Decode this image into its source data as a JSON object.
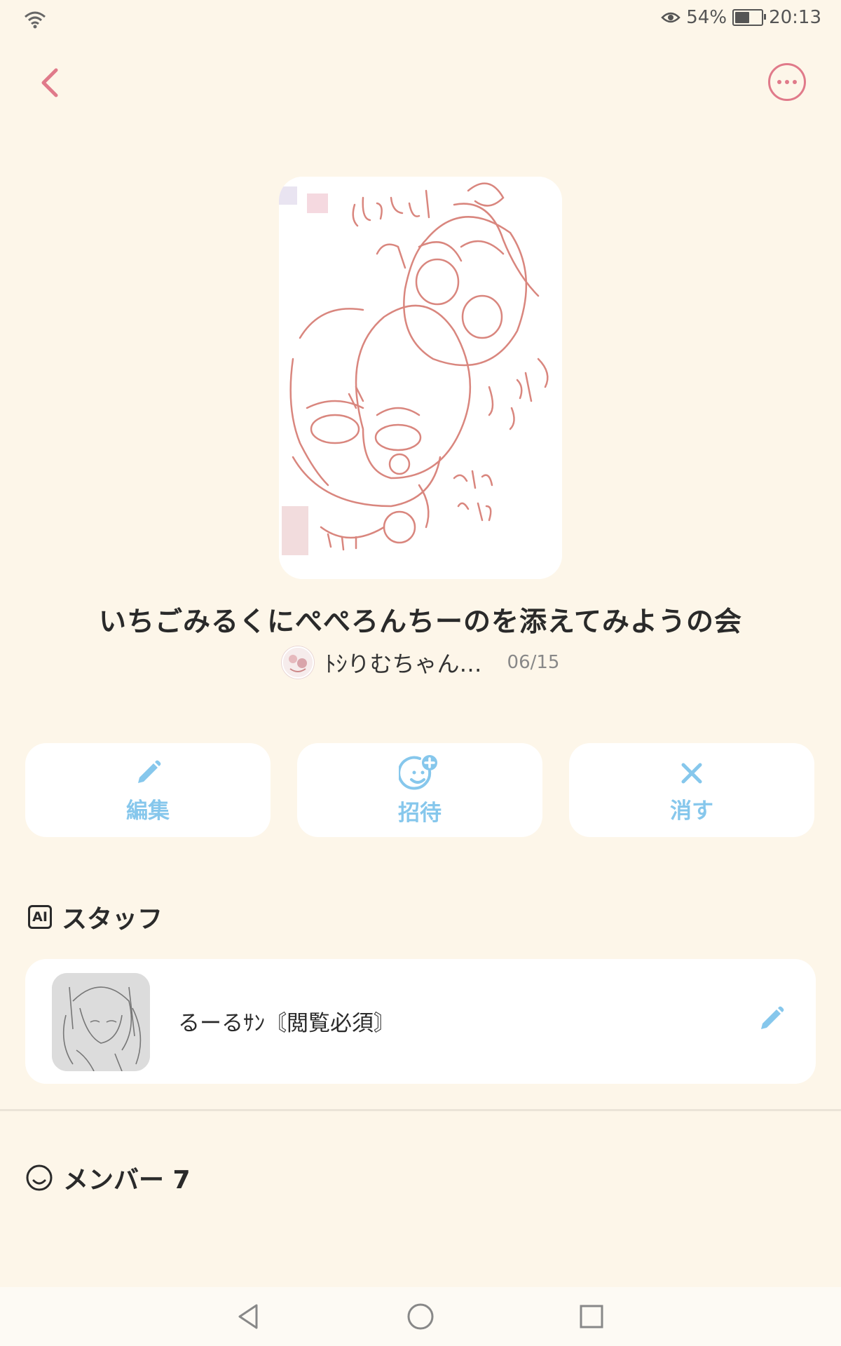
{
  "status_bar": {
    "battery_percent": "54%",
    "battery_level": 0.54,
    "time": "20:13",
    "icons": [
      "wifi-icon",
      "eye-icon",
      "battery-icon"
    ]
  },
  "header": {
    "back_icon": "chevron-left-icon",
    "more_icon": "more-horizontal-icon"
  },
  "group": {
    "title": "いちごみるくにぺぺろんちーのを添えてみようの会",
    "owner_name": "ﾄｼりむちゃん…",
    "date": "06/15"
  },
  "actions": [
    {
      "label": "編集",
      "icon": "pencil-icon"
    },
    {
      "label": "招待",
      "icon": "invite-smile-plus-icon"
    },
    {
      "label": "消す",
      "icon": "close-icon"
    }
  ],
  "staff": {
    "heading": "スタッフ",
    "badge": "AI",
    "member_name": "るーるｻﾝ〘閲覧必須〙",
    "edit_icon": "pencil-icon"
  },
  "members": {
    "heading": "メンバー 7",
    "icon": "smile-icon"
  },
  "nav_bar": {
    "icons": [
      "back-triangle-icon",
      "home-circle-icon",
      "recents-square-icon"
    ]
  },
  "colors": {
    "background": "#fdf6e9",
    "accent_pink": "#e07a8a",
    "accent_blue": "#86c7ec",
    "sketch_red": "#d9867e"
  }
}
